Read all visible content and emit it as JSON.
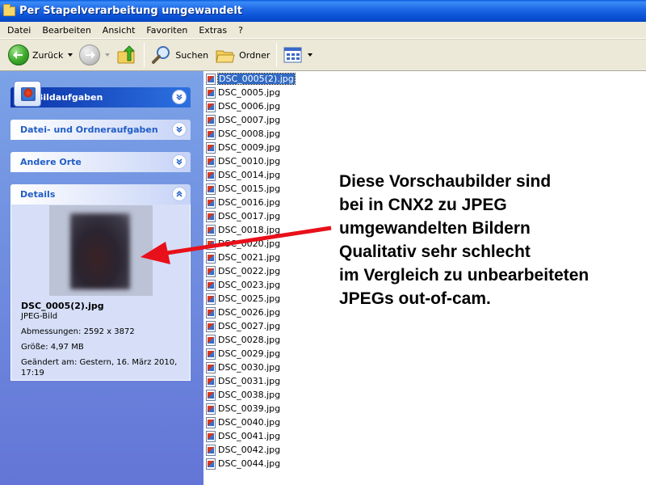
{
  "window": {
    "title": "Per Stapelverarbeitung umgewandelt"
  },
  "menu": [
    "Datei",
    "Bearbeiten",
    "Ansicht",
    "Favoriten",
    "Extras",
    "?"
  ],
  "toolbar": {
    "back_label": "Zurück",
    "search_label": "Suchen",
    "folders_label": "Ordner"
  },
  "tasks": {
    "bildaufgaben": "Bildaufgaben",
    "datei_ordner": "Datei- und Ordneraufgaben",
    "andere_orte": "Andere Orte",
    "details": "Details"
  },
  "details": {
    "filename": "DSC_0005(2).jpg",
    "type": "JPEG-Bild",
    "dimensions": "Abmessungen: 2592 x 3872",
    "size": "Größe: 4,97 MB",
    "modified_1": "Geändert am: Gestern, 16. März 2010,",
    "modified_2": "17:19"
  },
  "files": [
    "DSC_0005(2).jpg",
    "DSC_0005.jpg",
    "DSC_0006.jpg",
    "DSC_0007.jpg",
    "DSC_0008.jpg",
    "DSC_0009.jpg",
    "DSC_0010.jpg",
    "DSC_0014.jpg",
    "DSC_0015.jpg",
    "DSC_0016.jpg",
    "DSC_0017.jpg",
    "DSC_0018.jpg",
    "DSC_0020.jpg",
    "DSC_0021.jpg",
    "DSC_0022.jpg",
    "DSC_0023.jpg",
    "DSC_0025.jpg",
    "DSC_0026.jpg",
    "DSC_0027.jpg",
    "DSC_0028.jpg",
    "DSC_0029.jpg",
    "DSC_0030.jpg",
    "DSC_0031.jpg",
    "DSC_0038.jpg",
    "DSC_0039.jpg",
    "DSC_0040.jpg",
    "DSC_0041.jpg",
    "DSC_0042.jpg",
    "DSC_0044.jpg"
  ],
  "selected_file": "DSC_0005(2).jpg",
  "annotation": [
    "Diese Vorschaubilder sind",
    "bei in CNX2 zu JPEG",
    "umgewandelten Bildern",
    "Qualitativ sehr schlecht",
    "im Vergleich zu unbearbeiteten",
    "JPEGs out-of-cam."
  ],
  "colors": {
    "titlebar": "#0a52d6",
    "task_pane": "#6f8ede",
    "selection": "#316ac5",
    "arrow": "#e8101a"
  },
  "icons": {
    "title": "folder-open-icon",
    "back": "back-arrow-icon",
    "forward": "forward-arrow-icon",
    "up": "folder-up-icon",
    "search": "search-icon",
    "folders": "folders-icon",
    "views": "views-icon",
    "file": "jpeg-file-icon",
    "chevron": "chevron-icon"
  }
}
